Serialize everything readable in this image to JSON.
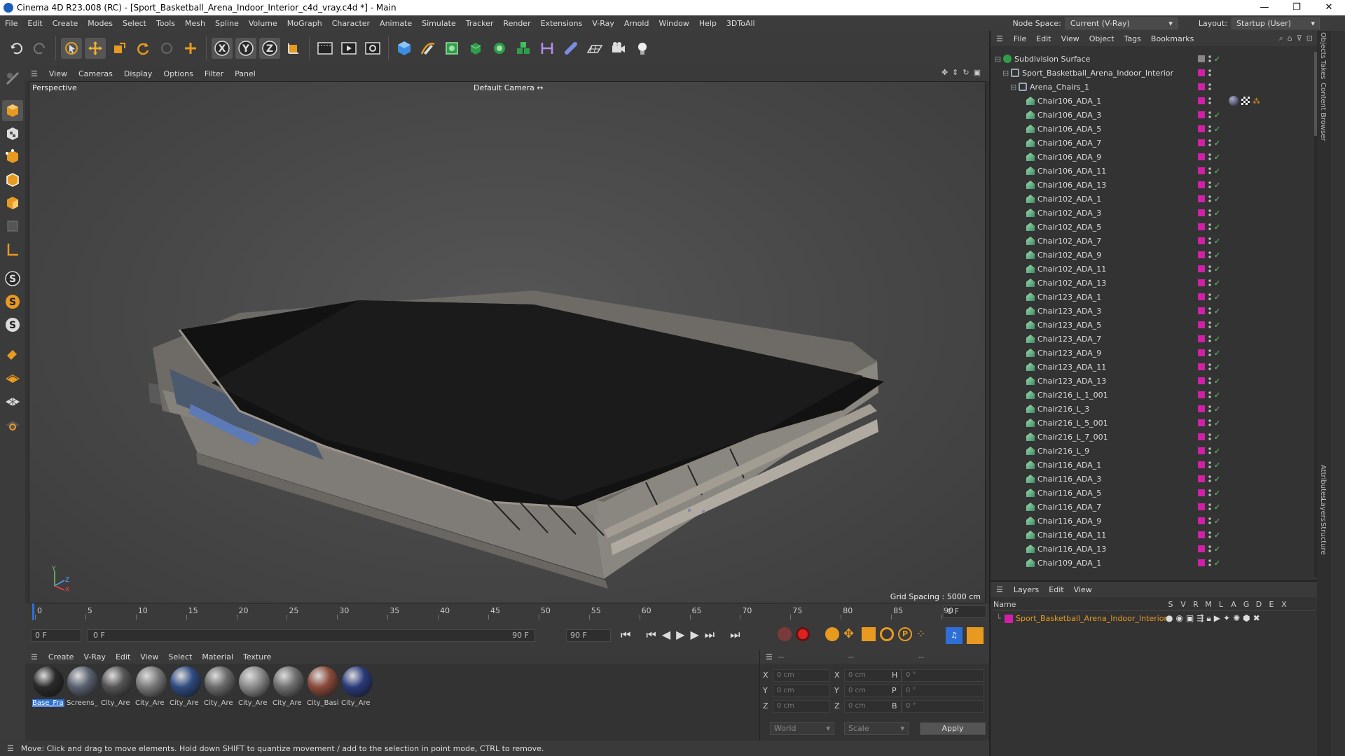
{
  "window": {
    "title": "Cinema 4D R23.008 (RC) - [Sport_Basketball_Arena_Indoor_Interior_c4d_vray.c4d *] - Main",
    "minimize": "—",
    "maximize": "❐",
    "close": "✕"
  },
  "menubar": {
    "items": [
      "File",
      "Edit",
      "Create",
      "Modes",
      "Select",
      "Tools",
      "Mesh",
      "Spline",
      "Volume",
      "MoGraph",
      "Character",
      "Animate",
      "Simulate",
      "Tracker",
      "Render",
      "Extensions",
      "V-Ray",
      "Arnold",
      "Window",
      "Help",
      "3DToAll"
    ],
    "node_space_label": "Node Space:",
    "node_space_value": "Current (V-Ray)",
    "layout_label": "Layout:",
    "layout_value": "Startup (User)"
  },
  "viewport": {
    "menu": [
      "View",
      "Cameras",
      "Display",
      "Options",
      "Filter",
      "Panel"
    ],
    "projection": "Perspective",
    "camera": "Default Camera",
    "grid_spacing": "Grid Spacing : 5000 cm"
  },
  "timeline": {
    "ticks": [
      "0",
      "5",
      "10",
      "15",
      "20",
      "25",
      "30",
      "35",
      "40",
      "45",
      "50",
      "55",
      "60",
      "65",
      "70",
      "75",
      "80",
      "85",
      "90"
    ],
    "current_frame": "0 F",
    "start_field": "0 F",
    "range_start": "0 F",
    "range_end": "90 F",
    "end_field": "90 F"
  },
  "materials": {
    "menu": [
      "Create",
      "V-Ray",
      "Edit",
      "View",
      "Select",
      "Material",
      "Texture"
    ],
    "items": [
      {
        "label": "Base_Fra",
        "color": "#2a2a2a"
      },
      {
        "label": "Screens_",
        "color": "#5a6070"
      },
      {
        "label": "City_Are",
        "color": "#555"
      },
      {
        "label": "City_Are",
        "color": "#7a7a7a"
      },
      {
        "label": "City_Are",
        "color": "#2f4b80"
      },
      {
        "label": "City_Are",
        "color": "#6a6a6a"
      },
      {
        "label": "City_Are",
        "color": "#8a8a8a"
      },
      {
        "label": "City_Are",
        "color": "#6f6f6f"
      },
      {
        "label": "City_Basi",
        "color": "#8a4a3a"
      },
      {
        "label": "City_Are",
        "color": "#2a3a7a"
      }
    ]
  },
  "coords": {
    "header": [
      "--",
      "--",
      "--"
    ],
    "rows": [
      {
        "a": "X",
        "av": "0 cm",
        "b": "X",
        "bv": "0 cm",
        "c": "H",
        "cv": "0 °"
      },
      {
        "a": "Y",
        "av": "0 cm",
        "b": "Y",
        "bv": "0 cm",
        "c": "P",
        "cv": "0 °"
      },
      {
        "a": "Z",
        "av": "0 cm",
        "b": "Z",
        "bv": "0 cm",
        "c": "B",
        "cv": "0 °"
      }
    ],
    "space": "World",
    "mode": "Scale",
    "apply": "Apply"
  },
  "status": "Move: Click and drag to move elements. Hold down SHIFT to quantize movement / add to the selection in point mode, CTRL to remove.",
  "objects": {
    "menu": [
      "File",
      "Edit",
      "View",
      "Object",
      "Tags",
      "Bookmarks"
    ],
    "items": [
      {
        "name": "Subdivision Surface",
        "indent": 0
      },
      {
        "name": "Sport_Basketball_Arena_Indoor_Interior",
        "indent": 1
      },
      {
        "name": "Arena_Chairs_1",
        "indent": 2
      },
      {
        "name": "Chair106_ADA_1",
        "indent": 3
      },
      {
        "name": "Chair106_ADA_3",
        "indent": 3
      },
      {
        "name": "Chair106_ADA_5",
        "indent": 3
      },
      {
        "name": "Chair106_ADA_7",
        "indent": 3
      },
      {
        "name": "Chair106_ADA_9",
        "indent": 3
      },
      {
        "name": "Chair106_ADA_11",
        "indent": 3
      },
      {
        "name": "Chair106_ADA_13",
        "indent": 3
      },
      {
        "name": "Chair102_ADA_1",
        "indent": 3
      },
      {
        "name": "Chair102_ADA_3",
        "indent": 3
      },
      {
        "name": "Chair102_ADA_5",
        "indent": 3
      },
      {
        "name": "Chair102_ADA_7",
        "indent": 3
      },
      {
        "name": "Chair102_ADA_9",
        "indent": 3
      },
      {
        "name": "Chair102_ADA_11",
        "indent": 3
      },
      {
        "name": "Chair102_ADA_13",
        "indent": 3
      },
      {
        "name": "Chair123_ADA_1",
        "indent": 3
      },
      {
        "name": "Chair123_ADA_3",
        "indent": 3
      },
      {
        "name": "Chair123_ADA_5",
        "indent": 3
      },
      {
        "name": "Chair123_ADA_7",
        "indent": 3
      },
      {
        "name": "Chair123_ADA_9",
        "indent": 3
      },
      {
        "name": "Chair123_ADA_11",
        "indent": 3
      },
      {
        "name": "Chair123_ADA_13",
        "indent": 3
      },
      {
        "name": "Chair216_L_1_001",
        "indent": 3
      },
      {
        "name": "Chair216_L_3",
        "indent": 3
      },
      {
        "name": "Chair216_L_5_001",
        "indent": 3
      },
      {
        "name": "Chair216_L_7_001",
        "indent": 3
      },
      {
        "name": "Chair216_L_9",
        "indent": 3
      },
      {
        "name": "Chair116_ADA_1",
        "indent": 3
      },
      {
        "name": "Chair116_ADA_3",
        "indent": 3
      },
      {
        "name": "Chair116_ADA_5",
        "indent": 3
      },
      {
        "name": "Chair116_ADA_7",
        "indent": 3
      },
      {
        "name": "Chair116_ADA_9",
        "indent": 3
      },
      {
        "name": "Chair116_ADA_11",
        "indent": 3
      },
      {
        "name": "Chair116_ADA_13",
        "indent": 3
      },
      {
        "name": "Chair109_ADA_1",
        "indent": 3
      }
    ]
  },
  "layers": {
    "menu": [
      "Layers",
      "Edit",
      "View"
    ],
    "col_name": "Name",
    "cols": [
      "S",
      "V",
      "R",
      "M",
      "L",
      "A",
      "G",
      "D",
      "E",
      "X"
    ],
    "layer_name": "Sport_Basketball_Arena_Indoor_Interior",
    "layer_color": "#d11fa8"
  },
  "side_tabs": [
    "Objects",
    "Takes",
    "Content Browser",
    "Attributes",
    "Layers",
    "Structure"
  ]
}
